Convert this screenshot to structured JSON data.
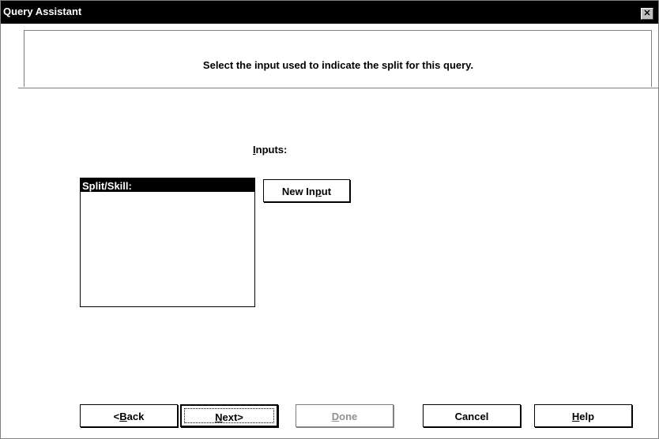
{
  "window": {
    "title": "Query Assistant",
    "close_glyph": "✕"
  },
  "instruction": "Select the input used to indicate the split for this query.",
  "inputs": {
    "label_pre": "",
    "label_key": "I",
    "label_post": "nputs:",
    "list_items": [
      "Split/Skill:"
    ],
    "new_input": {
      "pre": "New In",
      "key": "p",
      "post": "ut"
    }
  },
  "buttons": {
    "back": {
      "pre": "<",
      "key": "B",
      "post": "ack"
    },
    "next": {
      "pre": "",
      "key": "N",
      "post": "ext>"
    },
    "done": {
      "pre": "",
      "key": "D",
      "post": "one",
      "disabled": true
    },
    "cancel": {
      "label": "Cancel"
    },
    "help": {
      "pre": "",
      "key": "H",
      "post": "elp"
    }
  }
}
